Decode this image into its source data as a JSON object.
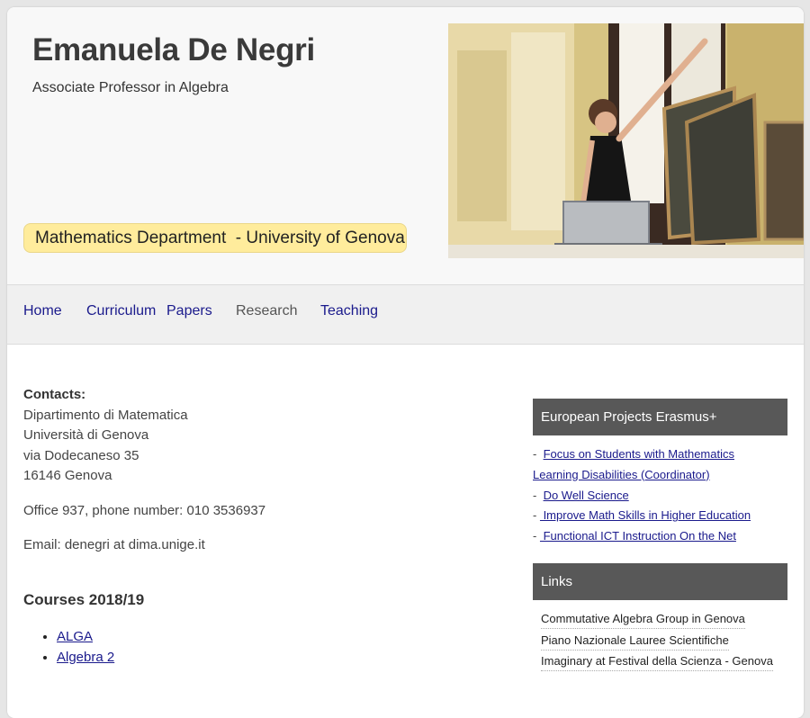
{
  "header": {
    "title": "Emanuela De Negri",
    "subtitle": "Associate Professor in Algebra",
    "department_badge": "Mathematics Department  - University of Genova",
    "badge_color": "#ffec9c"
  },
  "nav": {
    "items": [
      {
        "label": "Home",
        "current": false
      },
      {
        "label": "Curriculum",
        "current": false
      },
      {
        "label": "Papers",
        "current": false
      },
      {
        "label": "Research",
        "current": true
      },
      {
        "label": "Teaching",
        "current": false
      }
    ],
    "link_color": "#1a1a8c"
  },
  "contacts": {
    "label": "Contacts:",
    "address_lines": [
      "Dipartimento di Matematica",
      "Università di Genova",
      "via Dodecaneso 35",
      "16146 Genova"
    ],
    "office": "Office 937, phone number: 010 3536937",
    "email": "Email: denegri at dima.unige.it"
  },
  "courses": {
    "title": "Courses 2018/19",
    "items": [
      "ALGA",
      "Algebra 2"
    ]
  },
  "sidebar": {
    "erasmus": {
      "title": "European Projects Erasmus+",
      "items": [
        "Focus on Students with Mathematics Learning Disabilities (Coordinator)",
        "Do Well Science",
        " Improve Math Skills in Higher Education",
        " Functional ICT Instruction On the Net"
      ]
    },
    "links": {
      "title": "Links",
      "items": [
        "Commutative Algebra Group in Genova",
        "Piano Nazionale Lauree Scientifiche",
        "Imaginary at Festival della Scienza - Genova"
      ]
    },
    "box_color": "#585858"
  }
}
